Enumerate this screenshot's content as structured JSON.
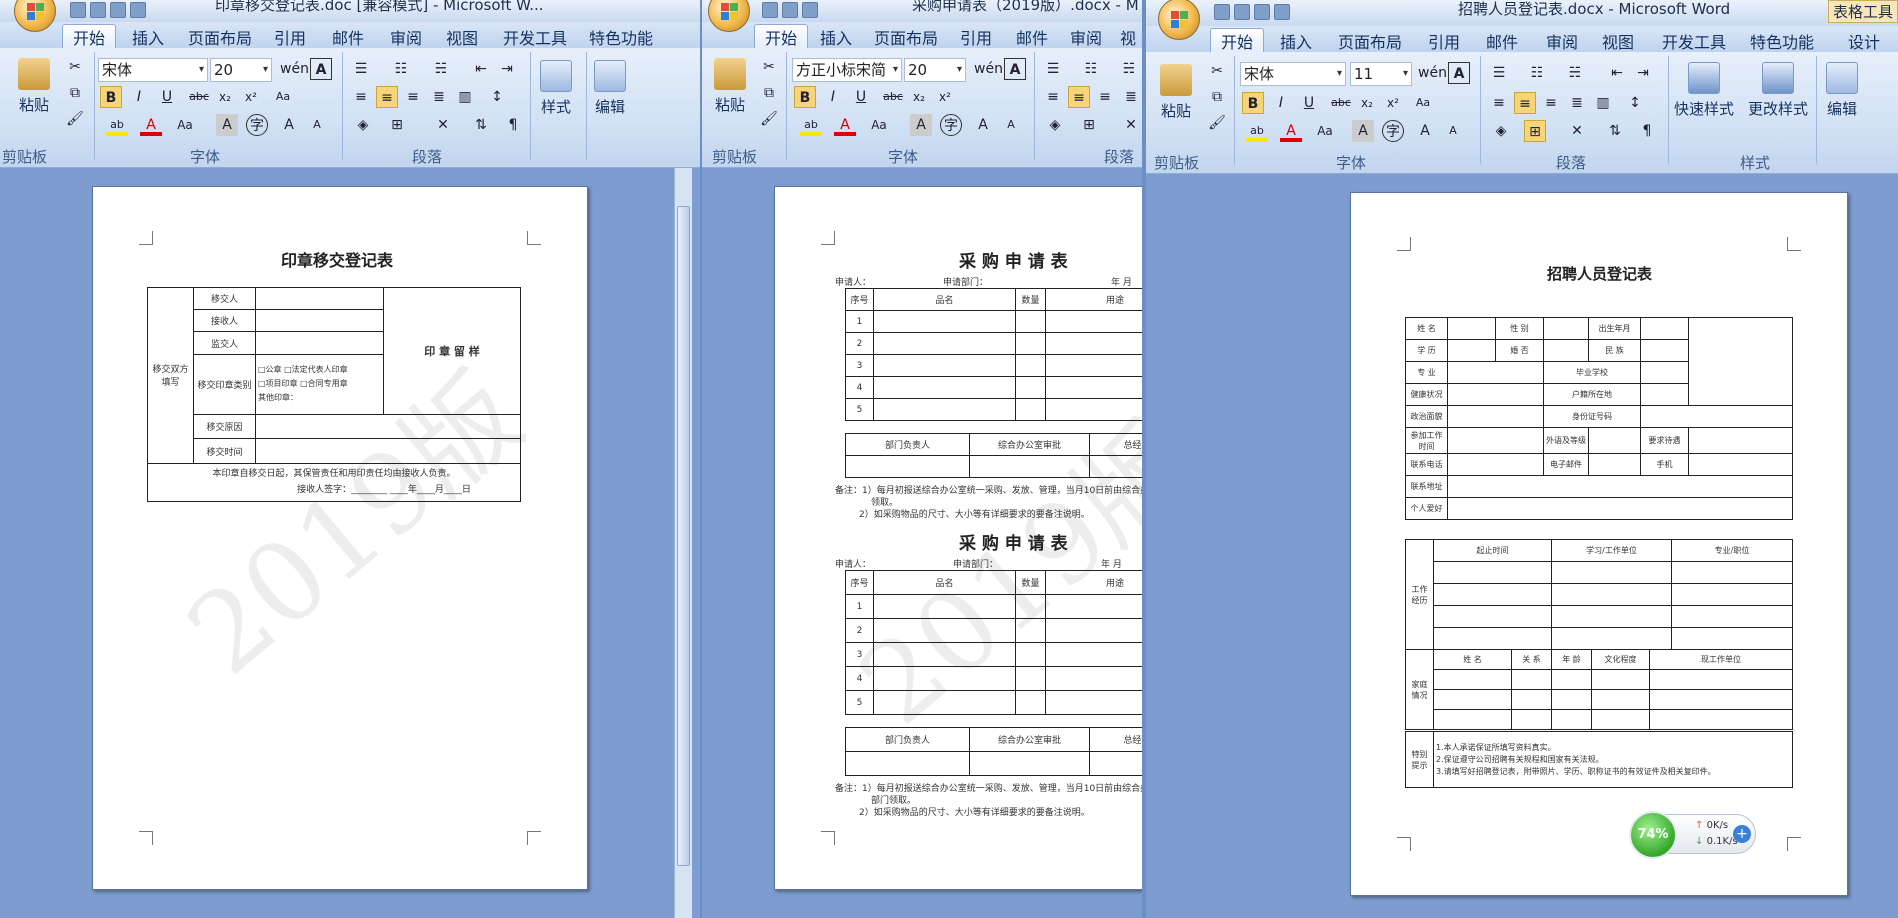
{
  "windows": [
    {
      "title": "印章移交登记表.doc [兼容模式] - Microsoft W...",
      "tabs": [
        "开始",
        "插入",
        "页面布局",
        "引用",
        "邮件",
        "审阅",
        "视图",
        "开发工具",
        "特色功能"
      ],
      "font": "宋体",
      "size": "20",
      "groups": [
        "剪贴板",
        "字体",
        "段落"
      ],
      "big": [
        "粘贴",
        "样式",
        "编辑"
      ]
    },
    {
      "title": "采购申请表（2019版）.docx - M",
      "tabs": [
        "开始",
        "插入",
        "页面布局",
        "引用",
        "邮件",
        "审阅",
        "视"
      ],
      "font": "方正小标宋简",
      "size": "20",
      "groups": [
        "剪贴板",
        "字体",
        "段落"
      ],
      "big": [
        "粘贴"
      ]
    },
    {
      "title": "招聘人员登记表.docx - Microsoft Word",
      "context_tab": "表格工具",
      "tabs": [
        "开始",
        "插入",
        "页面布局",
        "引用",
        "邮件",
        "审阅",
        "视图",
        "开发工具",
        "特色功能",
        "设计"
      ],
      "font": "宋体",
      "size": "11",
      "groups": [
        "剪贴板",
        "字体",
        "段落",
        "样式"
      ],
      "big": [
        "粘贴",
        "快速样式",
        "更改样式",
        "编辑"
      ]
    }
  ],
  "doc1": {
    "title": "印章移交登记表",
    "side": "移交双方填写",
    "rows": [
      "移交人",
      "接收人",
      "监交人"
    ],
    "kind_label": "移交印章类别",
    "kinds": [
      "□公章",
      "□法定代表人印章",
      "□项目印章",
      "□合同专用章",
      "其他印章："
    ],
    "stamp": "印 章 留 样",
    "reason": "移交原因",
    "time": "移交时间",
    "footer": "本印章自移交日起，其保管责任和用印责任均由接收人负责。",
    "sign": "接收人签字：________ ____年____月____日",
    "watermark": "2019版"
  },
  "doc2": {
    "title": "采 购 申 请 表",
    "applicant": "申请人：",
    "dept": "申请部门：",
    "year": "年    月",
    "headers": [
      "序号",
      "品名",
      "数量",
      "用途"
    ],
    "nums": [
      "1",
      "2",
      "3",
      "4",
      "5"
    ],
    "sign": [
      "部门负责人",
      "综合办公室审批",
      "总经理"
    ],
    "note1": "备注：1）每月初报送综合办公室统一采购、发放、管理，当月10日前由综合办",
    "note1b": "领取。",
    "note1c": "部门领取。",
    "note2": "2）如采购物品的尺寸、大小等有详细要求的要备注说明。",
    "watermark": "2019版"
  },
  "doc3": {
    "title": "招聘人员登记表",
    "name": "姓  名",
    "gender": "性  别",
    "birth": "出生年月",
    "edu": "学  历",
    "marriage": "婚  否",
    "nation": "民  族",
    "major": "专  业",
    "school": "毕业学校",
    "health": "健康状况",
    "hukou": "户籍所在地",
    "politics": "政治面貌",
    "idcard": "身份证号码",
    "worktime": "参加工作时间",
    "lang": "外语及等级",
    "salary": "要求待遇",
    "phone": "联系电话",
    "email": "电子邮件",
    "mobile": "手机",
    "addr": "联系地址",
    "hobby": "个人爱好",
    "work": "工作经历",
    "w_h": [
      "起止时间",
      "学习/工作单位",
      "专业/职位"
    ],
    "family": "家庭情况",
    "f_h": [
      "姓  名",
      "关  系",
      "年  龄",
      "文化程度",
      "现工作单位"
    ],
    "special": "特别提示",
    "tips": [
      "1.本人承诺保证所填写资料真实。",
      "2.保证遵守公司招聘有关规程和国家有关法规。",
      "3.请填写好招聘登记表，附带照片、学历、职称证书的有效证件及相关复印件。"
    ]
  },
  "net": {
    "percent": "74%",
    "up": "0K/s",
    "down": "0.1K/s"
  }
}
